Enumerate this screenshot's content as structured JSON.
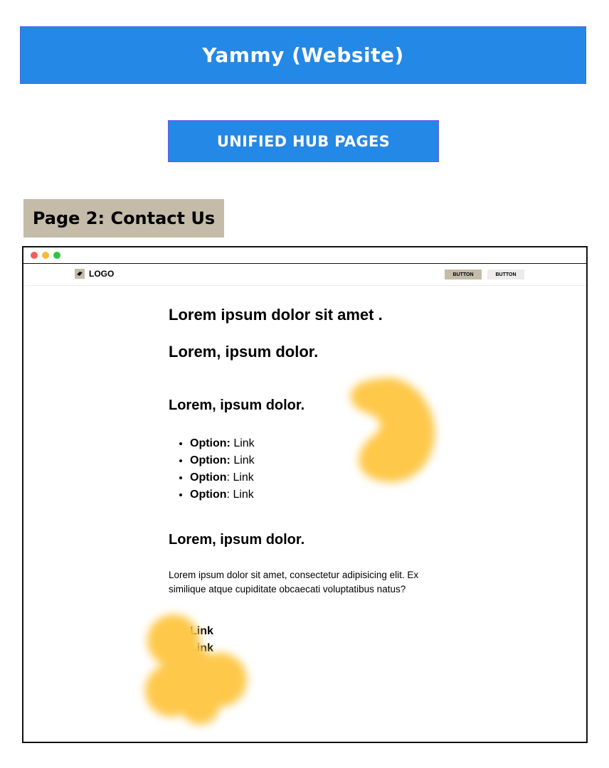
{
  "header": {
    "title": "Yammy (Website)",
    "subtitle": "UNIFIED HUB PAGES",
    "page_label": "Page 2: Contact Us"
  },
  "browser": {
    "nav": {
      "logo_text": "LOGO",
      "buttons": [
        "BUTTON",
        "BUTTON"
      ]
    },
    "content": {
      "heading_1": "Lorem ipsum dolor sit amet .",
      "heading_2": "Lorem, ipsum dolor.",
      "heading_3": "Lorem, ipsum dolor.",
      "options": [
        {
          "label": "Option:",
          "link": "Link"
        },
        {
          "label": "Option:",
          "link": "Link"
        },
        {
          "label": "Option",
          "sep": ":",
          "link": "Link"
        },
        {
          "label": "Option",
          "sep": ":",
          "link": "Link"
        }
      ],
      "heading_4": "Lorem, ipsum dolor.",
      "paragraph": "Lorem ipsum dolor sit amet, consectetur adipisicing elit. Ex similique atque cupiditate obcaecati voluptatibus natus?",
      "links": [
        "Link",
        "Link"
      ]
    }
  },
  "colors": {
    "banner_blue": "#2488e6",
    "label_beige": "#c4bba9",
    "blob_yellow": "#fec84a"
  }
}
